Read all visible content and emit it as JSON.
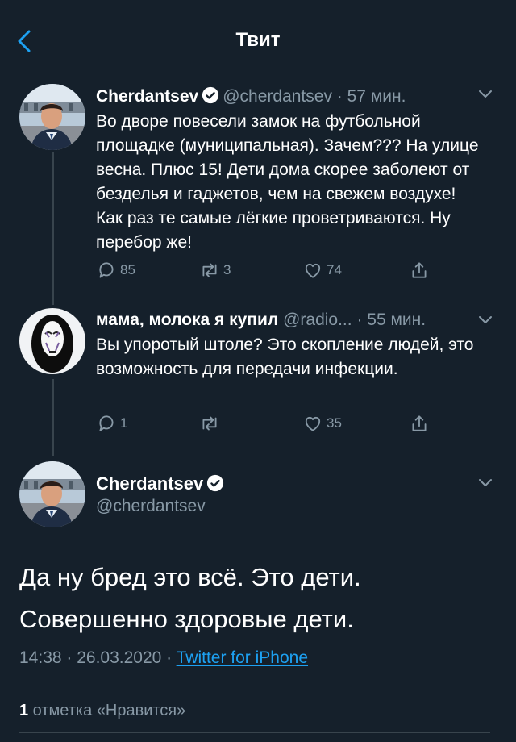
{
  "header": {
    "title": "Твит"
  },
  "tweet1": {
    "name": "Cherdantsev",
    "handle": "@cherdantsev",
    "time": "· 57 мин.",
    "text": "Во дворе повесели замок на футбольной площадке (муниципальная). Зачем??? На улице весна. Плюс 15! Дети дома скорее заболеют от безделья и гаджетов, чем на свежем воздухе! Как раз те самые лёгкие проветриваются. Ну перебор же!",
    "replies": "85",
    "retweets": "3",
    "likes": "74"
  },
  "tweet2": {
    "name": "мама, молока я купил",
    "handle": "@radio...",
    "time": "· 55 мин.",
    "text": "Вы упоротый штоле? Это скопление людей, это возможность для передачи инфекции.",
    "replies": "1",
    "retweets": "",
    "likes": "35"
  },
  "main_tweet": {
    "name": "Cherdantsev",
    "handle": "@cherdantsev",
    "text": "Да ну бред это всё. Это дети. Совершенно здоровые дети.",
    "timestamp": "14:38 · 26.03.2020 · ",
    "source": "Twitter for iPhone",
    "like_count": "1",
    "like_label": " отметка «Нравится»"
  },
  "colors": {
    "background": "#15202b",
    "accent": "#1da1f2",
    "muted": "#8899a6",
    "divider": "#38444d"
  },
  "icons": [
    "back-icon",
    "verified-icon",
    "chevron-down-icon",
    "reply-icon",
    "retweet-icon",
    "like-icon",
    "share-icon"
  ]
}
